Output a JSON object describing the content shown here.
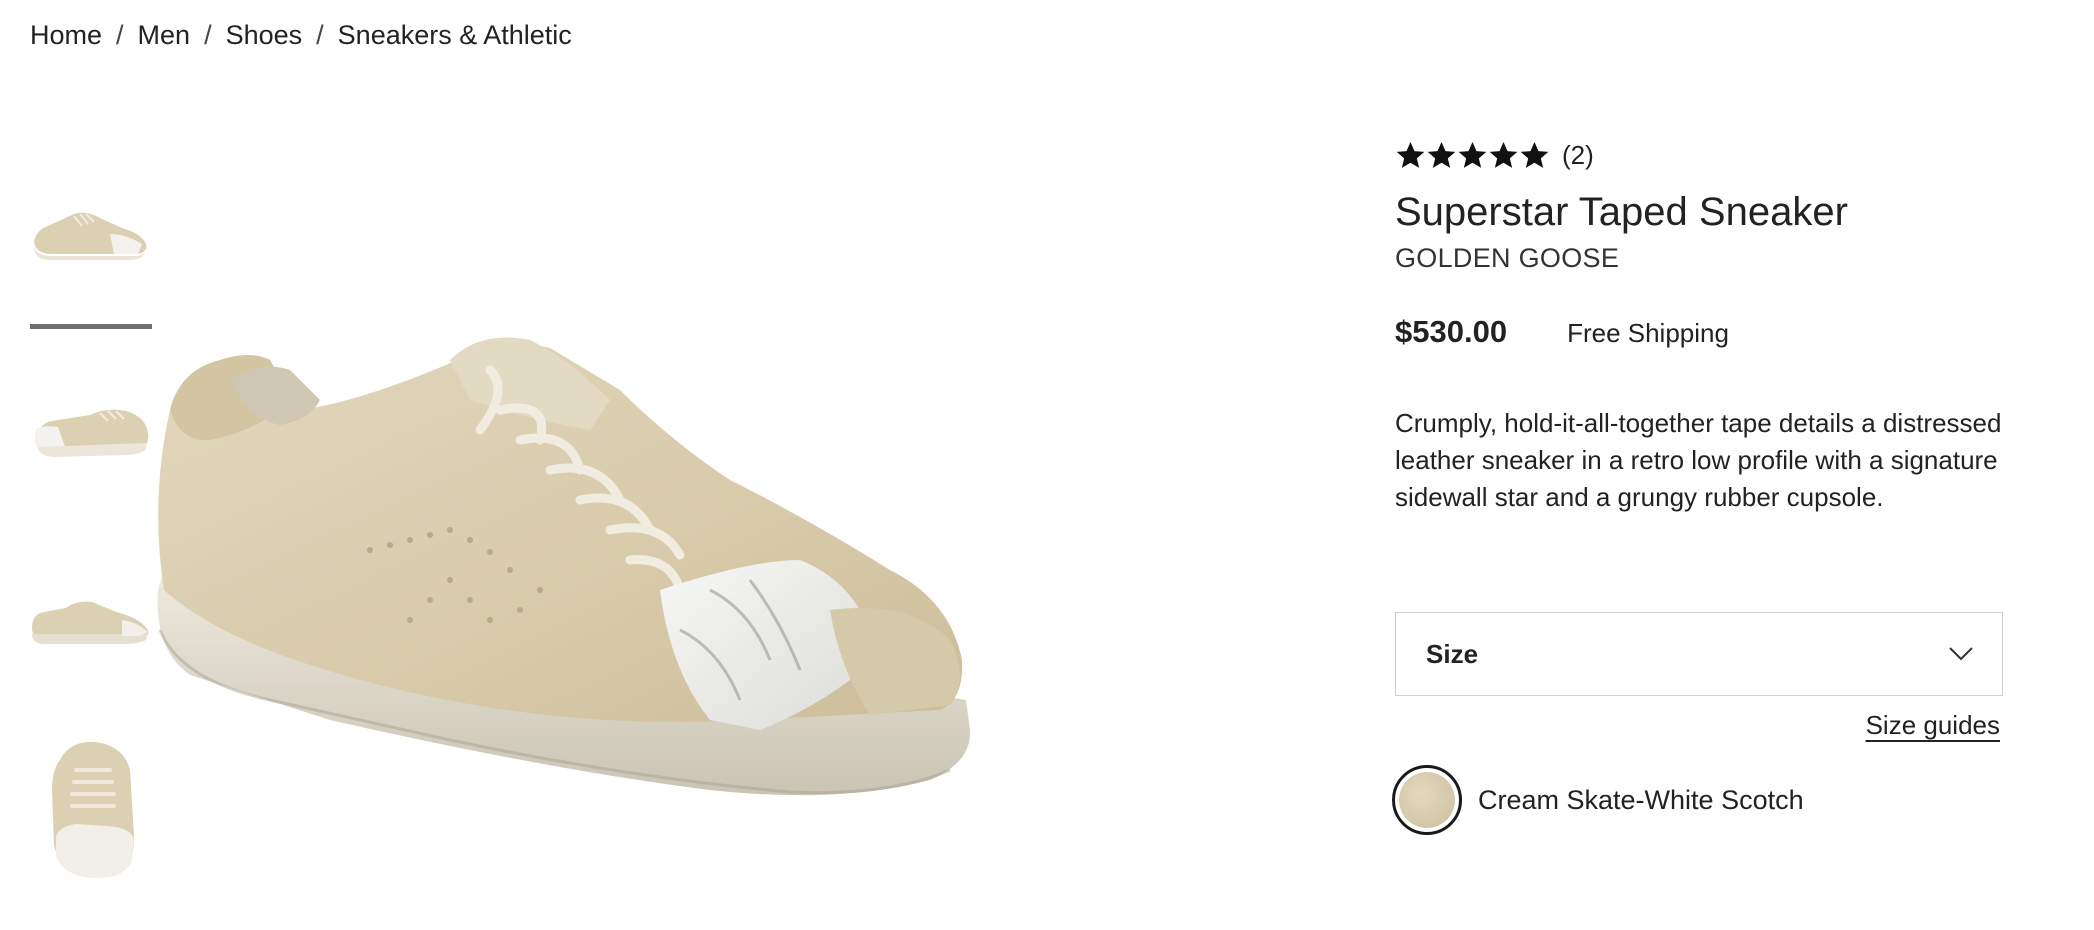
{
  "breadcrumb": {
    "items": [
      "Home",
      "Men",
      "Shoes",
      "Sneakers & Athletic"
    ],
    "separator": "/"
  },
  "gallery": {
    "thumbnail_count": 4,
    "active_index": 1
  },
  "product": {
    "rating_stars": 5,
    "review_count": "(2)",
    "title": "Superstar Taped Sneaker",
    "brand": "GOLDEN GOOSE",
    "price": "$530.00",
    "shipping": "Free Shipping",
    "description": "Crumply, hold-it-all-together tape details a distressed leather sneaker in a retro low profile with a signature sidewall star and a grungy rubber cupsole."
  },
  "size": {
    "label": "Size",
    "guides_link": "Size guides"
  },
  "color": {
    "selected_name": "Cream Skate-White Scotch",
    "swatch_color": "#d8cbad"
  },
  "icons": {
    "star": "star-icon",
    "chevron": "chevron-down-icon"
  }
}
